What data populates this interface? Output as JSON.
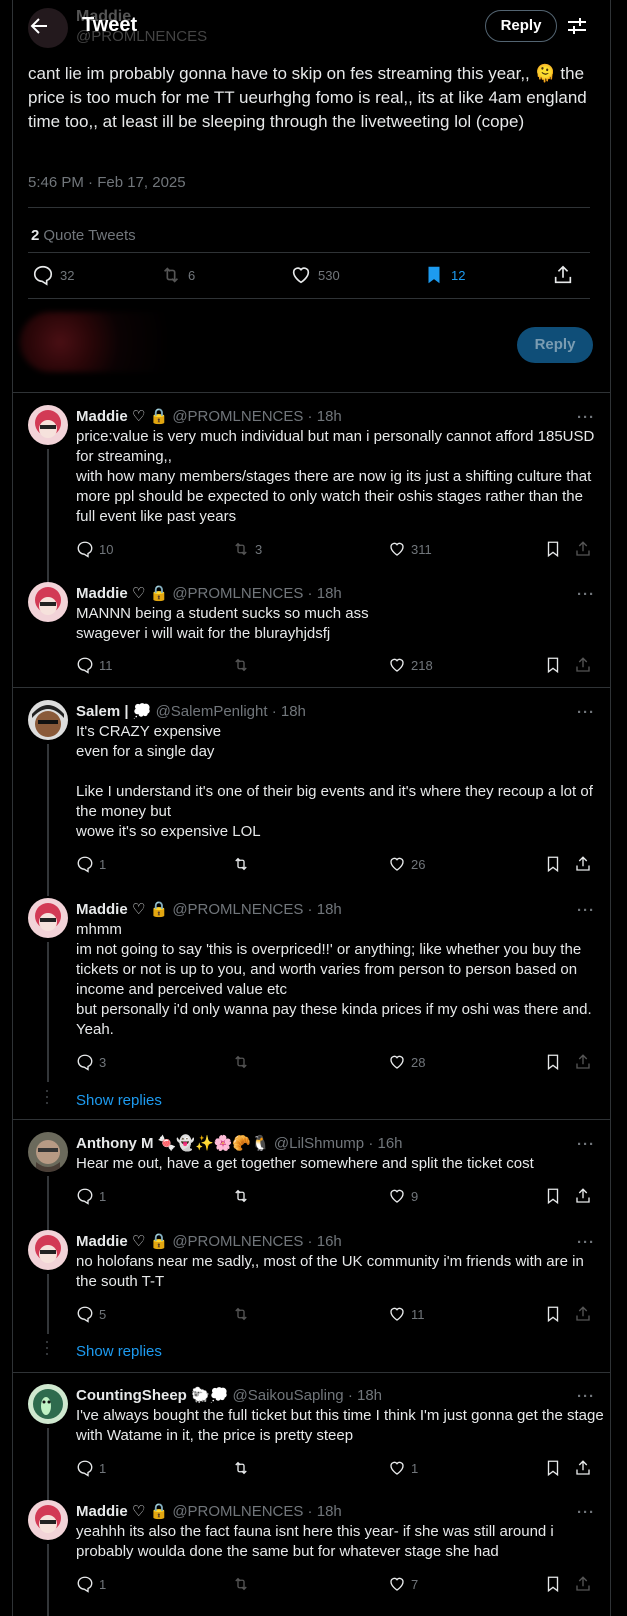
{
  "header": {
    "title": "Tweet",
    "reply_label": "Reply",
    "author_name": "Maddie",
    "author_handle": "@PROMLNENCES"
  },
  "tweet": {
    "text": "cant lie im probably gonna have to skip on fes streaming this year,, 🫠 the price is too much for me TT ueurhghg fomo is real,, its at like 4am england time too,, at least ill be sleeping through the livetweeting lol (cope)",
    "timestamp": "5:46 PM · Feb 17, 2025",
    "quote_count": "2",
    "quote_label": "Quote Tweets",
    "replies": "32",
    "retweets": "6",
    "likes": "530",
    "bookmarks": "12"
  },
  "compose": {
    "reply_label": "Reply"
  },
  "replies": [
    {
      "name": "Maddie ♡ 🔒",
      "handle": "@PROMLNENCES · 18h",
      "text": "price:value is very much individual but man i personally cannot afford 185USD for streaming,,\nwith how many members/stages there are now ig its just a shifting culture that more ppl should be expected to only watch their oshis stages rather than the full event like past years",
      "replies": "10",
      "retweets": "3",
      "likes": "311"
    },
    {
      "name": "Maddie ♡ 🔒",
      "handle": "@PROMLNENCES · 18h",
      "text": "MANNN being a student sucks so much ass\nswagever i will wait for the blurayhjdsfj",
      "replies": "11",
      "retweets": "",
      "likes": "218"
    },
    {
      "name": "Salem | 💭",
      "handle": "@SalemPenlight · 18h",
      "text": "It's CRAZY expensive\neven for a single day\n\nLike I understand it's one of their big events and it's where they recoup a lot of the money but\nwowe it's so expensive LOL",
      "replies": "1",
      "retweets": "",
      "likes": "26"
    },
    {
      "name": "Maddie ♡ 🔒",
      "handle": "@PROMLNENCES · 18h",
      "text": "mhmm\nim not going to say 'this is overpriced!!' or anything; like whether you buy the tickets or not is up to you, and worth varies from person to person based on income and perceived value etc\nbut personally i'd only wanna pay these kinda prices if my oshi was there and. Yeah.",
      "replies": "3",
      "retweets": "",
      "likes": "28"
    },
    {
      "name": "Anthony M 🍬👻✨🌸🥐🐧",
      "handle": "@LilShmump · 16h",
      "text": "Hear me out, have a get together somewhere and split the ticket cost",
      "replies": "1",
      "retweets": "",
      "likes": "9"
    },
    {
      "name": "Maddie ♡ 🔒",
      "handle": "@PROMLNENCES · 16h",
      "text": "no holofans near me sadly,, most of the UK community i'm friends with are in the south T-T",
      "replies": "5",
      "retweets": "",
      "likes": "11"
    },
    {
      "name": "CountingSheep 🐑💭",
      "handle": "@SaikouSapling · 18h",
      "text": "I've always bought the full ticket but this time I think I'm just gonna get the stage with Watame in it, the price is pretty steep",
      "replies": "1",
      "retweets": "",
      "likes": "1"
    },
    {
      "name": "Maddie ♡ 🔒",
      "handle": "@PROMLNENCES · 18h",
      "text": "yeahhh its also the fact fauna isnt here this year- if she was still around i probably woulda done the same but for whatever stage she had",
      "replies": "1",
      "retweets": "",
      "likes": "7"
    }
  ],
  "show_replies_label": "Show replies",
  "more_label": "···",
  "colors": {
    "accent": "#1d9bf0",
    "muted": "#71767b",
    "border": "#2f3336"
  }
}
